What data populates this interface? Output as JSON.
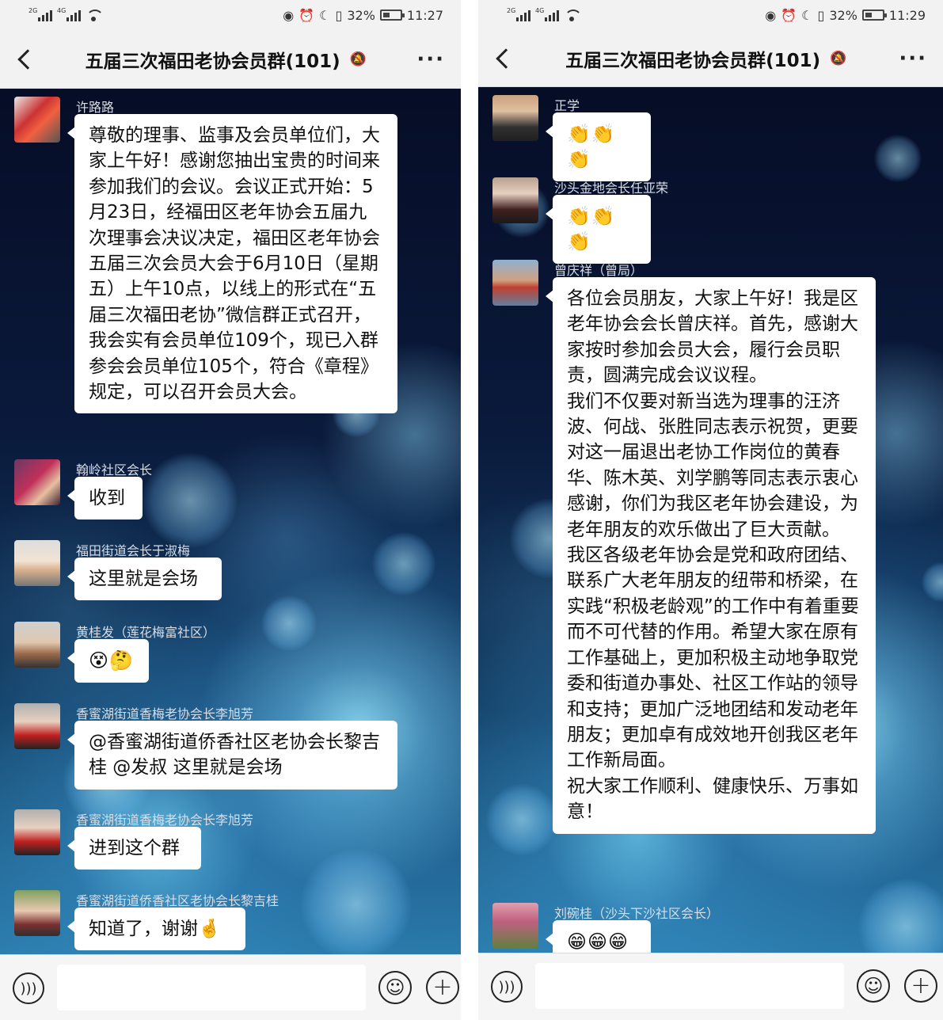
{
  "left": {
    "status": {
      "net1": "2G",
      "net2": "4G",
      "battery": "32%",
      "time": "11:27"
    },
    "title": "五届三次福田老协会员群(101)",
    "messages": [
      {
        "sender": "许路路",
        "text": "尊敬的理事、监事及会员单位们，大家上午好！感谢您抽出宝贵的时间来参加我们的会议。会议正式开始：5月23日，经福田区老年协会五届九次理事会决议决定，福田区老年协会五届三次会员大会于6月10日（星期五）上午10点，以线上的形式在“五届三次福田老协”微信群正式召开，我会实有会员单位109个，现已入群参会会员单位105个，符合《章程》规定，可以召开会员大会。"
      },
      {
        "sender": "翰岭社区会长",
        "text": "收到"
      },
      {
        "sender": "福田街道会长于淑梅",
        "text": "这里就是会场"
      },
      {
        "sender": "黄桂发（莲花梅富社区）",
        "text": "😵🤔"
      },
      {
        "sender": "香蜜湖街道香梅老协会长李旭芳",
        "text": "@香蜜湖街道侨香社区老协会长黎吉桂 @发叔  这里就是会场"
      },
      {
        "sender": "香蜜湖街道香梅老协会长李旭芳",
        "text": "进到这个群"
      },
      {
        "sender": "香蜜湖街道侨香社区老协会长黎吉桂",
        "text": "知道了，谢谢🤞"
      }
    ]
  },
  "right": {
    "status": {
      "net1": "2G",
      "net2": "4G",
      "battery": "32%",
      "time": "11:29"
    },
    "title": "五届三次福田老协会员群(101)",
    "messages": [
      {
        "sender": "正学",
        "text": "👏👏👏"
      },
      {
        "sender": "沙头金地会长任亚荣",
        "text": "👏👏👏"
      },
      {
        "sender": "曾庆祥（曾局）",
        "text": "各位会员朋友，大家上午好！我是区老年协会会长曾庆祥。首先，感谢大家按时参加会员大会，履行会员职责，圆满完成会议议程。\n我们不仅要对新当选为理事的汪济波、何战、张胜同志表示祝贺，更要对这一届退出老协工作岗位的黄春华、陈木英、刘学鹏等同志表示衷心感谢，你们为我区老年协会建设，为老年朋友的欢乐做出了巨大贡献。\n我区各级老年协会是党和政府团结、联系广大老年朋友的纽带和桥梁，在实践“积极老龄观”的工作中有着重要而不可代替的作用。希望大家在原有工作基础上，更加积极主动地争取党委和街道办事处、社区工作站的领导和支持；更加广泛地团结和发动老年朋友；更加卓有成效地开创我区老年工作新局面。\n祝大家工作顺利、健康快乐、万事如意！"
      },
      {
        "sender": "刘碗桂（沙头下沙社区会长）",
        "text": "😁😁😁"
      }
    ]
  },
  "icons": {
    "voice": "voice-icon",
    "emoji": "emoji-icon",
    "plus": "plus-icon",
    "back": "back-arrow-icon",
    "more": "more-icon",
    "mute": "mute-bell-icon"
  }
}
